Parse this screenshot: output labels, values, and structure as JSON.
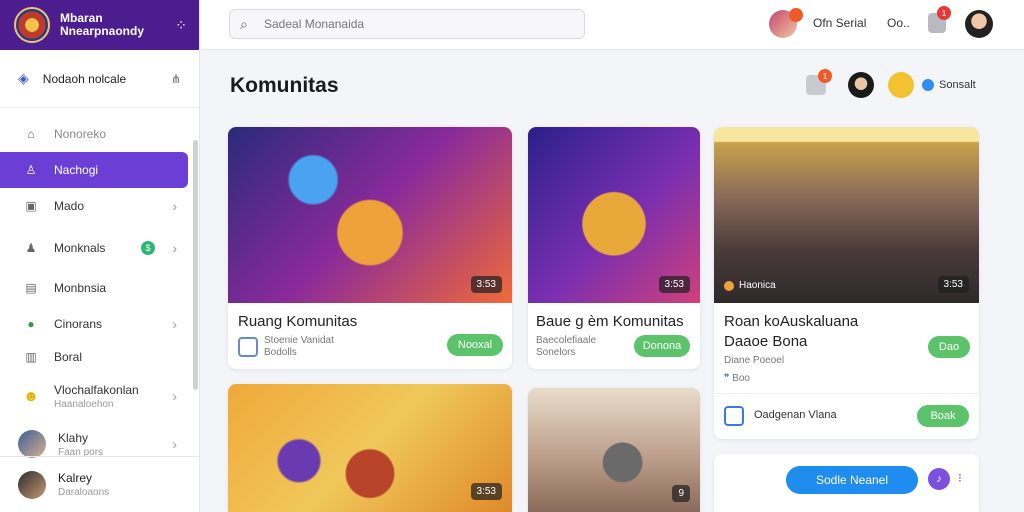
{
  "brand": {
    "name_line1": "Mbaran",
    "name_line2": "Nnearpnaondy"
  },
  "sidebar": {
    "top_item": {
      "label": "Nodaoh nolcale"
    },
    "items": [
      {
        "label": "Nonoreko",
        "icon": "home-icon",
        "faded": true
      },
      {
        "label": "Nachogi",
        "icon": "user-icon",
        "active": true
      },
      {
        "label": "Mado",
        "icon": "doc-icon",
        "chevron": true
      },
      {
        "label": "Monknals",
        "icon": "person-icon",
        "chevron": true,
        "badge": "$"
      },
      {
        "label": "Monbnsia",
        "icon": "image-icon"
      },
      {
        "label": "Cinorans",
        "icon": "globe-icon",
        "chevron": true
      },
      {
        "label": "Boral",
        "icon": "lock-icon"
      }
    ],
    "item_two_line": {
      "label": "Vlochalfakonlan",
      "sub": "Haanaloehon"
    },
    "item_avatar": {
      "label": "Klahy",
      "sub": "Faan pors"
    },
    "profile": {
      "name": "Kalrey",
      "sub": "Daraloaons"
    }
  },
  "topbar": {
    "search_placeholder": "Sadeal Monanaida",
    "user_name": "Ofn Serial",
    "short_text": "Oo..",
    "notif_count": "1"
  },
  "page": {
    "title": "Komunitas",
    "header_link": "Sonsalt",
    "header_badge": "1"
  },
  "cards": [
    {
      "title": "Ruang Komunitas",
      "sub1": "Stoenie Vanidat",
      "sub2": "Bodolls",
      "button": "Nooxal",
      "count": "3:53"
    },
    {
      "title": "Baue g èm Komunitas",
      "sub1": "Baecolefiaale",
      "sub2": "Sonelors",
      "button": "Donona",
      "count": "3:53"
    },
    {
      "title": "Roan koAuskaluana",
      "title2": "Daaoe Bona",
      "sub1": "Diane Poeoel",
      "sub2": "Boo",
      "button": "Dao",
      "count": "3:53",
      "overlay_label": "Haonica"
    },
    {
      "count": "3:53"
    },
    {
      "count": "9"
    },
    {
      "row_label": "Oadgenan Vlana",
      "button": "Boak",
      "cta": "Sodle Neanel",
      "cta_badge": "♪"
    }
  ]
}
